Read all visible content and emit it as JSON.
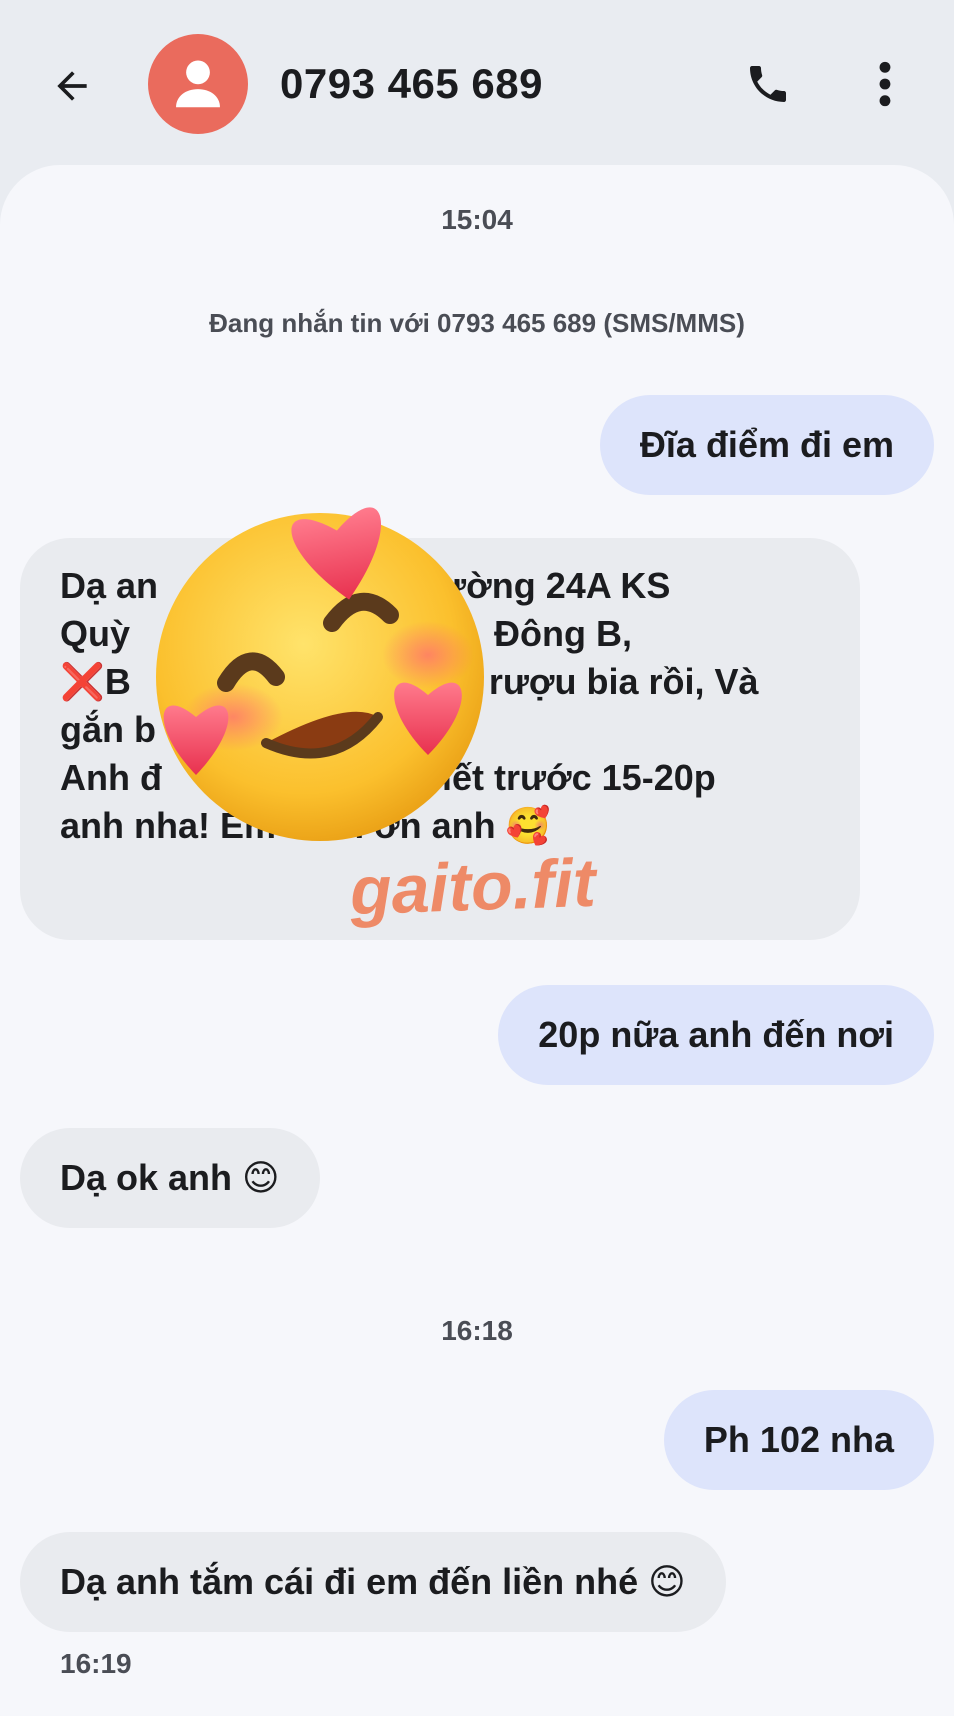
{
  "header": {
    "contact_name": "0793 465 689",
    "back_icon": "arrow-left-icon",
    "avatar_icon": "person-icon",
    "call_icon": "phone-icon",
    "more_icon": "more-vert-icon",
    "avatar_color": "#ea6b5d"
  },
  "conversation": {
    "timestamp_1": "15:04",
    "info_text": "Đang nhắn tin với 0793 465 689 (SMS/MMS)",
    "timestamp_2": "16:18",
    "last_time": "16:19"
  },
  "messages": [
    {
      "direction": "outgoing",
      "text": "Đĩa điểm đi em"
    },
    {
      "direction": "incoming",
      "lines": [
        "Dạ an",
        "Đường 24A KS",
        "Quỳ",
        "Đông B,",
        "❌",
        "B",
        "rượu bia rồi, Và",
        "gắn b",
        "Anh đ",
        "h biết trước 15-20p",
        "anh nha! Em Cảm ơn anh",
        "🥰"
      ]
    },
    {
      "direction": "outgoing",
      "text": "20p nữa anh đến nơi"
    },
    {
      "direction": "incoming",
      "text": "Dạ ok anh 😊"
    },
    {
      "direction": "outgoing",
      "text": "Ph 102 nha"
    },
    {
      "direction": "incoming",
      "text": "Dạ anh tắm cái đi em đến liền nhé 😊"
    }
  ],
  "overlay": {
    "sticker_icon": "smiling-face-with-hearts-icon",
    "watermark_text": "gaito.fit"
  },
  "colors": {
    "outgoing_bubble": "#dde4fb",
    "incoming_bubble": "#e9ebef",
    "background": "#f6f7fb",
    "header_bg": "#e9ecf1"
  }
}
